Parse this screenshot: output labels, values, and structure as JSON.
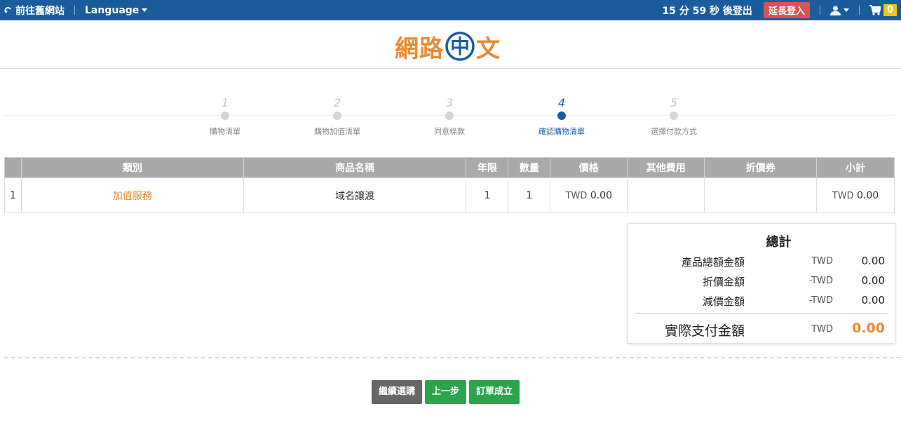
{
  "topbar": {
    "old_site": "前往舊網站",
    "language": "Language",
    "countdown": "15 分 59 秒 後登出",
    "extend_login": "延長登入",
    "cart_count": "0"
  },
  "logo": {
    "text_left": "網路",
    "text_middle": "中",
    "text_right": "文"
  },
  "steps": [
    {
      "num": "1",
      "label": "購物清單",
      "active": false
    },
    {
      "num": "2",
      "label": "購物加值清單",
      "active": false
    },
    {
      "num": "3",
      "label": "同意條款",
      "active": false
    },
    {
      "num": "4",
      "label": "確認購物清單",
      "active": true
    },
    {
      "num": "5",
      "label": "選擇付款方式",
      "active": false
    }
  ],
  "table": {
    "headers": [
      "",
      "類別",
      "商品名稱",
      "年限",
      "數量",
      "價格",
      "其他費用",
      "折價券",
      "小計"
    ],
    "rows": [
      {
        "index": "1",
        "category": "加值服務",
        "product": "域名讓渡",
        "years": "1",
        "qty": "1",
        "price_currency": "TWD",
        "price": "0.00",
        "other_fee": "",
        "coupon": "",
        "subtotal_currency": "TWD",
        "subtotal": "0.00"
      }
    ]
  },
  "summary": {
    "title": "總計",
    "product_total_label": "產品總額金額",
    "product_total_currency": "TWD",
    "product_total": "0.00",
    "discount_label": "折價金額",
    "discount_currency": "-TWD",
    "discount": "0.00",
    "reduction_label": "減價金額",
    "reduction_currency": "-TWD",
    "reduction": "0.00",
    "pay_label": "實際支付金額",
    "pay_currency": "TWD",
    "pay": "0.00"
  },
  "buttons": {
    "continue": "繼續選購",
    "prev": "上一步",
    "submit": "訂單成立"
  },
  "colors": {
    "brand_blue": "#1b5c9c",
    "accent_orange": "#e88a33",
    "green": "#2aa54a",
    "red": "#d9534f"
  }
}
